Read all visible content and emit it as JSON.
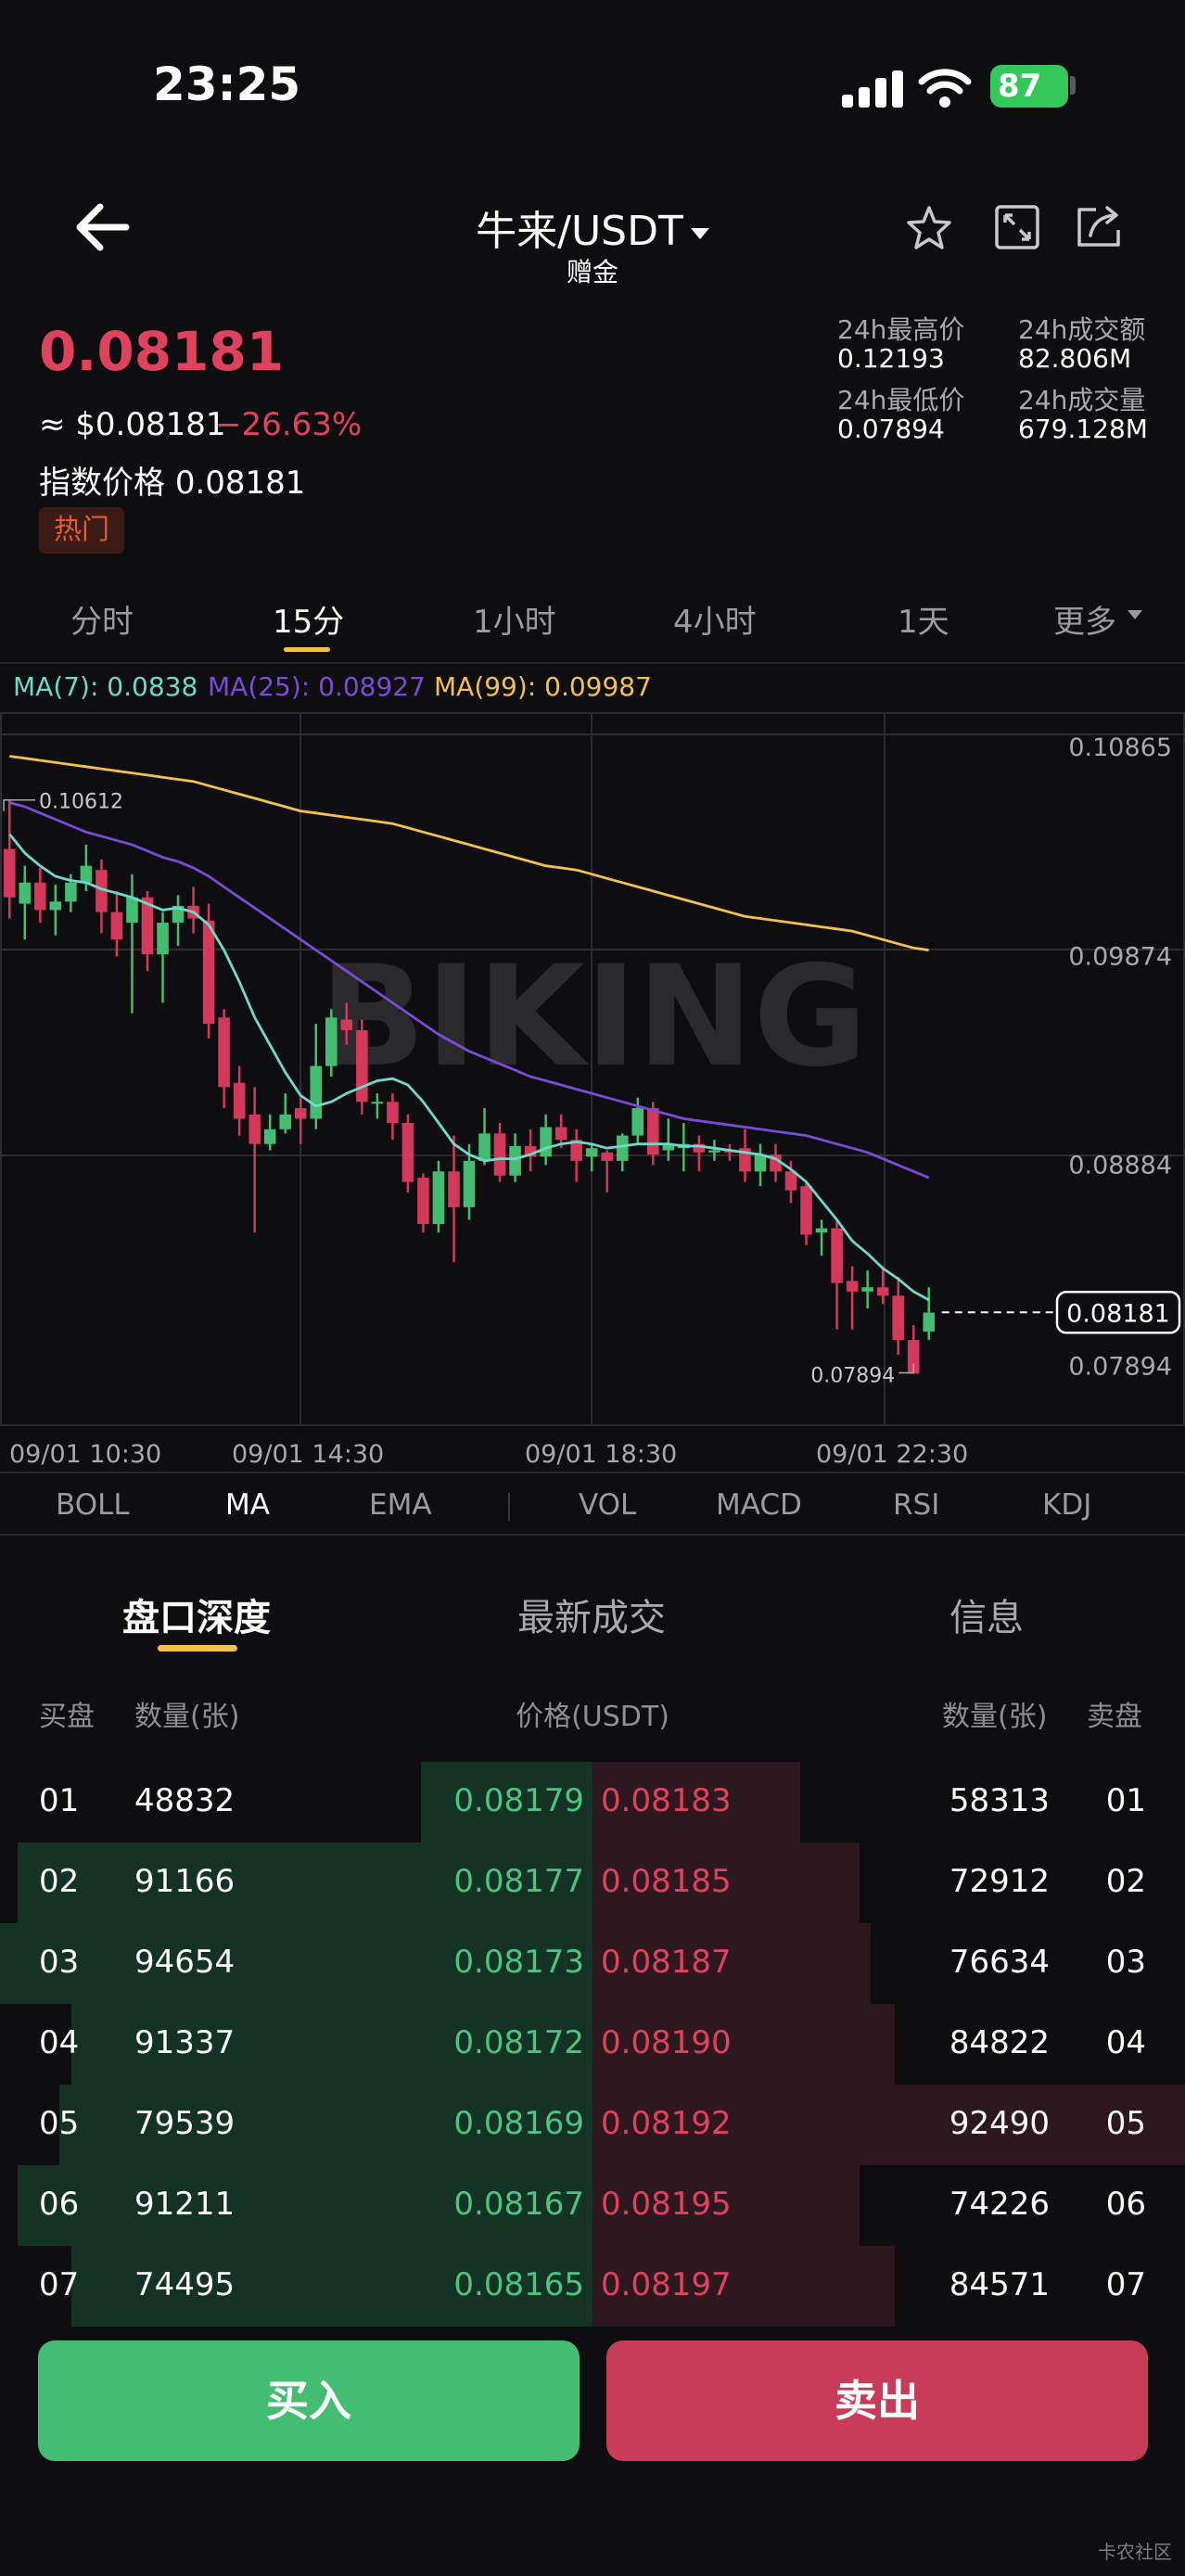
{
  "status_bar": {
    "time": "23:25",
    "battery": "87"
  },
  "header": {
    "pair": "牛来/USDT",
    "subtitle": "赠金"
  },
  "price": {
    "last": "0.08181",
    "usd": "≈ $0.08181",
    "change": "−26.63%",
    "index_label": "指数价格",
    "index_value": "0.08181",
    "tag": "热门"
  },
  "stats": {
    "high_label": "24h最高价",
    "high": "0.12193",
    "low_label": "24h最低价",
    "low": "0.07894",
    "turnover_label": "24h成交额",
    "turnover": "82.806M",
    "volume_label": "24h成交量",
    "volume": "679.128M"
  },
  "timeframes": [
    "分时",
    "15分",
    "1小时",
    "4小时",
    "1天",
    "更多"
  ],
  "active_timeframe": "15分",
  "ma_legend": {
    "ma7": "MA(7): 0.0838",
    "ma25": "MA(25): 0.08927",
    "ma99": "MA(99): 0.09987"
  },
  "chart_data": {
    "type": "candlestick",
    "watermark": "BIKING",
    "y_ticks": [
      "0.10865",
      "0.09874",
      "0.08884",
      "0.07894"
    ],
    "ylim": [
      0.0765,
      0.1102
    ],
    "x_labels": [
      "09/01 10:30",
      "09/01 14:30",
      "09/01 18:30",
      "09/01 22:30"
    ],
    "high_marker": "0.10612",
    "low_marker": "0.07894",
    "current_price": "0.08181",
    "candles": [
      [
        0.1038,
        0.1015,
        0.1061,
        0.1005
      ],
      [
        0.1012,
        0.1022,
        0.103,
        0.0995
      ],
      [
        0.1022,
        0.1009,
        0.1029,
        0.1003
      ],
      [
        0.1009,
        0.1013,
        0.1021,
        0.0997
      ],
      [
        0.1013,
        0.1022,
        0.1026,
        0.1008
      ],
      [
        0.1022,
        0.103,
        0.104,
        0.1018
      ],
      [
        0.1028,
        0.1008,
        0.1033,
        0.0998
      ],
      [
        0.1008,
        0.0995,
        0.1018,
        0.0987
      ],
      [
        0.1003,
        0.1015,
        0.1026,
        0.096
      ],
      [
        0.1015,
        0.0988,
        0.1018,
        0.098
      ],
      [
        0.0988,
        0.1003,
        0.1008,
        0.0965
      ],
      [
        0.1003,
        0.1011,
        0.1016,
        0.0992
      ],
      [
        0.1011,
        0.1005,
        0.102,
        0.0998
      ],
      [
        0.1004,
        0.0955,
        0.1012,
        0.0948
      ],
      [
        0.0958,
        0.0925,
        0.0962,
        0.0915
      ],
      [
        0.0927,
        0.091,
        0.0935,
        0.0902
      ],
      [
        0.0912,
        0.0898,
        0.0925,
        0.0856
      ],
      [
        0.0898,
        0.0905,
        0.0912,
        0.0895
      ],
      [
        0.0905,
        0.0912,
        0.0922,
        0.0903
      ],
      [
        0.0915,
        0.091,
        0.092,
        0.0898
      ],
      [
        0.091,
        0.0935,
        0.0955,
        0.0905
      ],
      [
        0.0935,
        0.0958,
        0.0962,
        0.093
      ],
      [
        0.0957,
        0.0952,
        0.0965,
        0.0945
      ],
      [
        0.0952,
        0.0918,
        0.0957,
        0.0912
      ],
      [
        0.0918,
        0.0918,
        0.0922,
        0.091
      ],
      [
        0.0918,
        0.0908,
        0.0922,
        0.09
      ],
      [
        0.0908,
        0.088,
        0.0912,
        0.0875
      ],
      [
        0.0882,
        0.086,
        0.0884,
        0.0856
      ],
      [
        0.086,
        0.0885,
        0.089,
        0.0856
      ],
      [
        0.0885,
        0.0868,
        0.0902,
        0.0842
      ],
      [
        0.0868,
        0.089,
        0.0898,
        0.0862
      ],
      [
        0.089,
        0.0903,
        0.0915,
        0.0888
      ],
      [
        0.0903,
        0.0883,
        0.0908,
        0.088
      ],
      [
        0.0883,
        0.0897,
        0.0903,
        0.088
      ],
      [
        0.0897,
        0.0892,
        0.0905,
        0.0885
      ],
      [
        0.0892,
        0.0906,
        0.0912,
        0.0888
      ],
      [
        0.0906,
        0.09,
        0.0912,
        0.0896
      ],
      [
        0.09,
        0.089,
        0.0905,
        0.088
      ],
      [
        0.0892,
        0.0896,
        0.0898,
        0.0885
      ],
      [
        0.0894,
        0.089,
        0.0895,
        0.0875
      ],
      [
        0.089,
        0.0902,
        0.0903,
        0.0885
      ],
      [
        0.0902,
        0.0915,
        0.092,
        0.0898
      ],
      [
        0.0915,
        0.0893,
        0.0918,
        0.0888
      ],
      [
        0.0895,
        0.0898,
        0.091,
        0.089
      ],
      [
        0.0896,
        0.0898,
        0.0908,
        0.0885
      ],
      [
        0.0898,
        0.0894,
        0.0902,
        0.0885
      ],
      [
        0.0894,
        0.0895,
        0.09,
        0.089
      ],
      [
        0.0895,
        0.0894,
        0.0898,
        0.089
      ],
      [
        0.0896,
        0.0885,
        0.0905,
        0.088
      ],
      [
        0.0885,
        0.0893,
        0.0898,
        0.0878
      ],
      [
        0.0893,
        0.0885,
        0.0898,
        0.088
      ],
      [
        0.0885,
        0.0876,
        0.089,
        0.087
      ],
      [
        0.0878,
        0.0855,
        0.088,
        0.085
      ],
      [
        0.0856,
        0.0858,
        0.0862,
        0.0845
      ],
      [
        0.0858,
        0.0832,
        0.0862,
        0.081
      ],
      [
        0.0833,
        0.0828,
        0.084,
        0.081
      ],
      [
        0.0828,
        0.083,
        0.0838,
        0.082
      ],
      [
        0.083,
        0.0826,
        0.084,
        0.0822
      ],
      [
        0.0826,
        0.0805,
        0.0835,
        0.0798
      ],
      [
        0.0805,
        0.0789,
        0.0812,
        0.0789
      ],
      [
        0.0809,
        0.0818,
        0.083,
        0.0805
      ]
    ],
    "ma7": [
      0.1045,
      0.1036,
      0.103,
      0.1025,
      0.1023,
      0.1022,
      0.1019,
      0.1017,
      0.1015,
      0.1012,
      0.1009,
      0.101,
      0.1008,
      0.1002,
      0.099,
      0.0975,
      0.0958,
      0.0945,
      0.0932,
      0.0921,
      0.0916,
      0.0918,
      0.0922,
      0.0925,
      0.0928,
      0.0929,
      0.0926,
      0.0918,
      0.0908,
      0.0898,
      0.0893,
      0.089,
      0.0891,
      0.0891,
      0.0893,
      0.0896,
      0.0898,
      0.0899,
      0.0898,
      0.0896,
      0.0897,
      0.0898,
      0.0898,
      0.0898,
      0.0897,
      0.0897,
      0.0896,
      0.0895,
      0.0894,
      0.0893,
      0.0891,
      0.0886,
      0.088,
      0.0871,
      0.0862,
      0.0852,
      0.0846,
      0.0839,
      0.0834,
      0.0828,
      0.0824
    ],
    "ma25": [
      0.106,
      0.1058,
      0.1055,
      0.1052,
      0.1049,
      0.1046,
      0.1044,
      0.1042,
      0.104,
      0.1037,
      0.1034,
      0.1032,
      0.1029,
      0.1025,
      0.102,
      0.1015,
      0.101,
      0.1005,
      0.1,
      0.0995,
      0.099,
      0.0985,
      0.098,
      0.0975,
      0.097,
      0.0965,
      0.096,
      0.0955,
      0.095,
      0.0946,
      0.0942,
      0.0939,
      0.0936,
      0.0933,
      0.093,
      0.0928,
      0.0926,
      0.0924,
      0.0922,
      0.092,
      0.0918,
      0.0916,
      0.0914,
      0.0912,
      0.091,
      0.0909,
      0.0908,
      0.0907,
      0.0906,
      0.0905,
      0.0904,
      0.0903,
      0.0902,
      0.09,
      0.0898,
      0.0896,
      0.0894,
      0.0891,
      0.0888,
      0.0885,
      0.0882
    ],
    "ma99": [
      0.1082,
      0.1081,
      0.108,
      0.1079,
      0.1078,
      0.1077,
      0.1076,
      0.1075,
      0.1074,
      0.1073,
      0.1072,
      0.1071,
      0.107,
      0.1068,
      0.1066,
      0.1064,
      0.1062,
      0.106,
      0.1058,
      0.1056,
      0.1055,
      0.1054,
      0.1053,
      0.1052,
      0.1051,
      0.105,
      0.1048,
      0.1046,
      0.1044,
      0.1042,
      0.104,
      0.1038,
      0.1036,
      0.1034,
      0.1032,
      0.103,
      0.1029,
      0.1028,
      0.1026,
      0.1024,
      0.1022,
      0.102,
      0.1018,
      0.1016,
      0.1014,
      0.1012,
      0.101,
      0.1008,
      0.1006,
      0.1005,
      0.1004,
      0.1003,
      0.1002,
      0.1001,
      0.1,
      0.0999,
      0.0997,
      0.0995,
      0.0993,
      0.0991,
      0.099
    ],
    "colors": {
      "up": "#43bd72",
      "down": "#d4385a",
      "ma7": "#6fd8c8",
      "ma25": "#7a4bd6",
      "ma99": "#f3c04e"
    }
  },
  "indicators": [
    "BOLL",
    "MA",
    "EMA",
    "VOL",
    "MACD",
    "RSI",
    "KDJ"
  ],
  "active_indicator": "MA",
  "orderbook": {
    "tabs": [
      "盘口深度",
      "最新成交",
      "信息"
    ],
    "headers": {
      "bid_side": "买盘",
      "bid_qty": "数量(张)",
      "price": "价格(USDT)",
      "ask_qty": "数量(张)",
      "ask_side": "卖盘"
    },
    "rows": [
      {
        "no": "01",
        "bid_qty": "48832",
        "bid_price": "0.08179",
        "ask_price": "0.08183",
        "ask_qty": "58313",
        "bid_depth": 0.29,
        "ask_depth": 0.35
      },
      {
        "no": "02",
        "bid_qty": "91166",
        "bid_price": "0.08177",
        "ask_price": "0.08185",
        "ask_qty": "72912",
        "bid_depth": 0.97,
        "ask_depth": 0.45
      },
      {
        "no": "03",
        "bid_qty": "94654",
        "bid_price": "0.08173",
        "ask_price": "0.08187",
        "ask_qty": "76634",
        "bid_depth": 1.0,
        "ask_depth": 0.47
      },
      {
        "no": "04",
        "bid_qty": "91337",
        "bid_price": "0.08172",
        "ask_price": "0.08190",
        "ask_qty": "84822",
        "bid_depth": 0.88,
        "ask_depth": 0.51
      },
      {
        "no": "05",
        "bid_qty": "79539",
        "bid_price": "0.08169",
        "ask_price": "0.08192",
        "ask_qty": "92490",
        "bid_depth": 0.9,
        "ask_depth": 1.0
      },
      {
        "no": "06",
        "bid_qty": "91211",
        "bid_price": "0.08167",
        "ask_price": "0.08195",
        "ask_qty": "74226",
        "bid_depth": 0.97,
        "ask_depth": 0.45
      },
      {
        "no": "07",
        "bid_qty": "74495",
        "bid_price": "0.08165",
        "ask_price": "0.08197",
        "ask_qty": "84571",
        "bid_depth": 0.88,
        "ask_depth": 0.51
      }
    ]
  },
  "actions": {
    "buy": "买入",
    "sell": "卖出"
  },
  "watermark_text": "卡农社区"
}
